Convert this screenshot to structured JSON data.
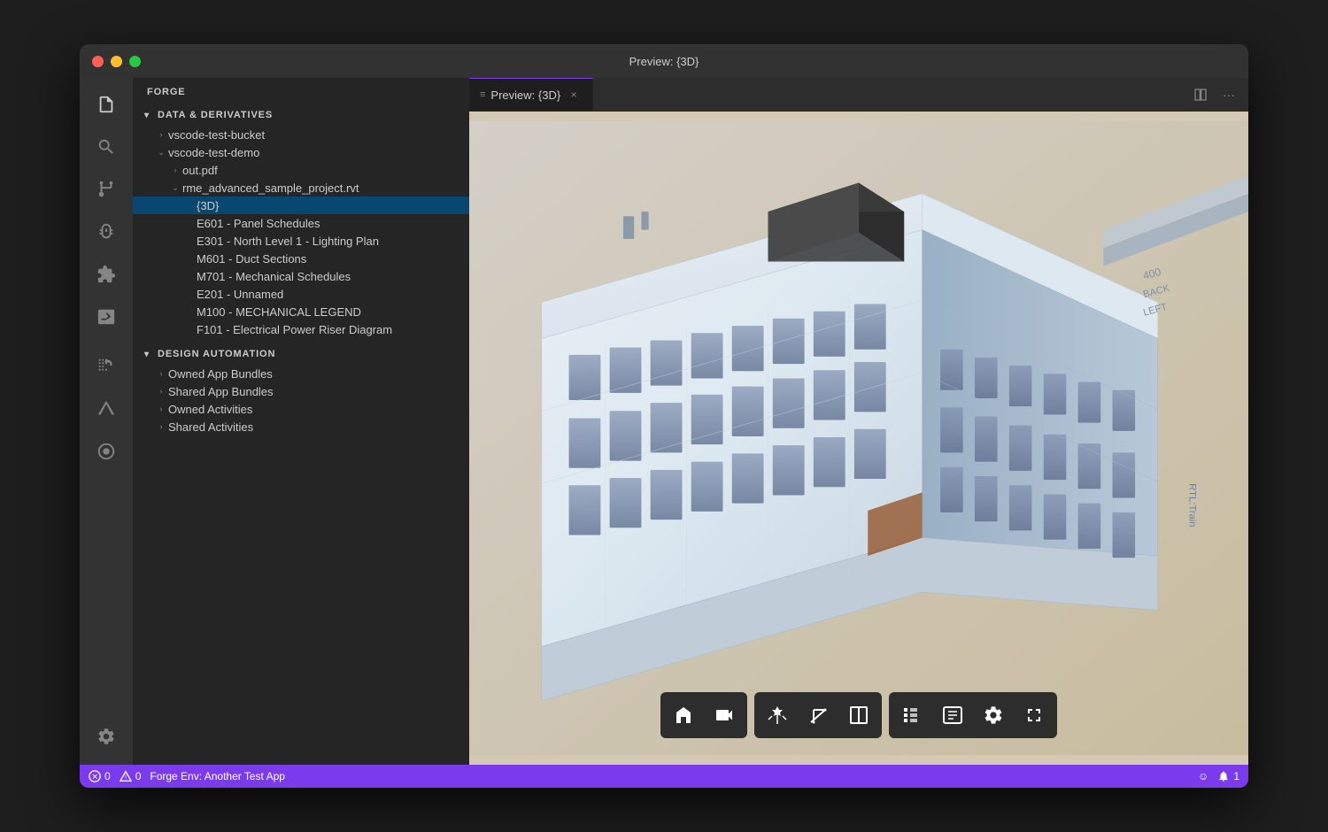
{
  "window": {
    "title": "Preview: {3D}"
  },
  "titlebar": {
    "title": "Preview: {3D}"
  },
  "sidebar": {
    "header": "FORGE",
    "sections": [
      {
        "id": "data-derivatives",
        "label": "DATA & DERIVATIVES",
        "expanded": true,
        "items": [
          {
            "id": "vscode-test-bucket",
            "label": "vscode-test-bucket",
            "indent": 1,
            "hasChevron": true,
            "expanded": false
          },
          {
            "id": "vscode-test-demo",
            "label": "vscode-test-demo",
            "indent": 1,
            "hasChevron": true,
            "expanded": true
          },
          {
            "id": "out-pdf",
            "label": "out.pdf",
            "indent": 2,
            "hasChevron": true,
            "expanded": false
          },
          {
            "id": "rme-rvt",
            "label": "rme_advanced_sample_project.rvt",
            "indent": 2,
            "hasChevron": true,
            "expanded": true
          },
          {
            "id": "3d",
            "label": "{3D}",
            "indent": 3,
            "hasChevron": false,
            "selected": true
          },
          {
            "id": "e601",
            "label": "E601 - Panel Schedules",
            "indent": 3,
            "hasChevron": false
          },
          {
            "id": "e301",
            "label": "E301 - North Level 1 - Lighting Plan",
            "indent": 3,
            "hasChevron": false
          },
          {
            "id": "m601",
            "label": "M601 - Duct Sections",
            "indent": 3,
            "hasChevron": false
          },
          {
            "id": "m701",
            "label": "M701 - Mechanical Schedules",
            "indent": 3,
            "hasChevron": false
          },
          {
            "id": "e201",
            "label": "E201 - Unnamed",
            "indent": 3,
            "hasChevron": false
          },
          {
            "id": "m100",
            "label": "M100 - MECHANICAL LEGEND",
            "indent": 3,
            "hasChevron": false
          },
          {
            "id": "f101",
            "label": "F101 - Electrical Power Riser Diagram",
            "indent": 3,
            "hasChevron": false
          }
        ]
      },
      {
        "id": "design-automation",
        "label": "DESIGN AUTOMATION",
        "expanded": true,
        "items": [
          {
            "id": "owned-app-bundles",
            "label": "Owned App Bundles",
            "indent": 1,
            "hasChevron": true,
            "expanded": false
          },
          {
            "id": "shared-app-bundles",
            "label": "Shared App Bundles",
            "indent": 1,
            "hasChevron": true,
            "expanded": false
          },
          {
            "id": "owned-activities",
            "label": "Owned Activities",
            "indent": 1,
            "hasChevron": true,
            "expanded": false
          },
          {
            "id": "shared-activities",
            "label": "Shared Activities",
            "indent": 1,
            "hasChevron": true,
            "expanded": false
          }
        ]
      }
    ]
  },
  "tab": {
    "icon": "≡",
    "label": "Preview: {3D}",
    "close": "×"
  },
  "tabbar_actions": {
    "split": "⊟",
    "more": "···"
  },
  "activity_icons": {
    "files": "❑",
    "search": "⌕",
    "git": "⌥",
    "debug": "⚙",
    "extensions": "⊞",
    "terminal": "▷",
    "docker": "🐋",
    "forge_a": "▲",
    "forge_circle": "◉",
    "settings": "⚙"
  },
  "viewer_toolbar": {
    "group1": [
      "person",
      "camera"
    ],
    "group2": [
      "explode",
      "measure",
      "section"
    ],
    "group3": [
      "hierarchy",
      "properties",
      "settings",
      "fullscreen"
    ]
  },
  "status_bar": {
    "errors": "0",
    "warnings": "0",
    "env_text": "Forge Env: Another Test App",
    "smiley": "☺",
    "bell": "🔔",
    "bell_count": "1"
  }
}
